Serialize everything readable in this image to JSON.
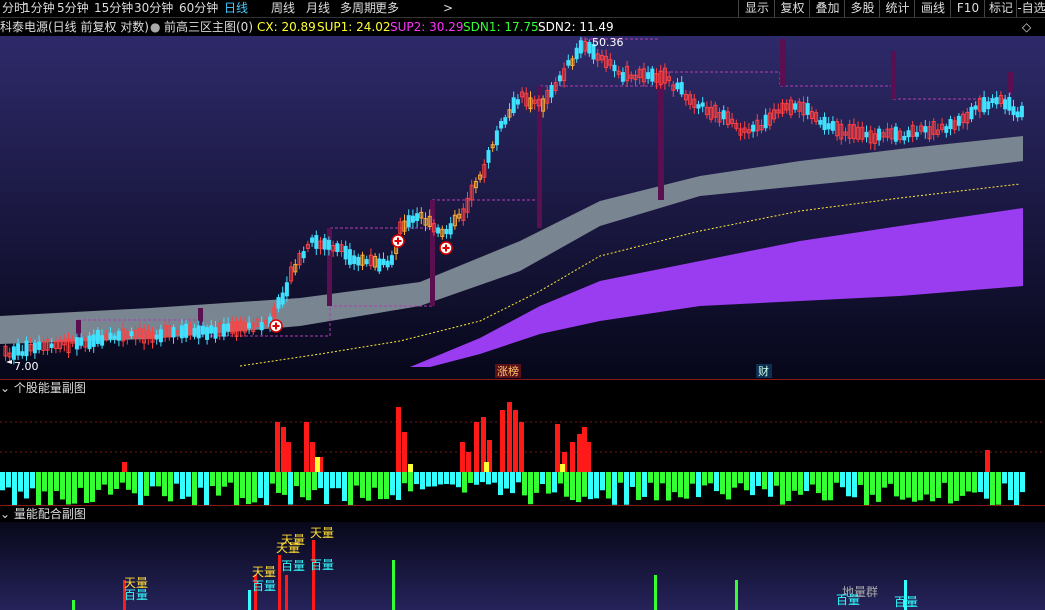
{
  "toolbar": {
    "timeframes": [
      "分时",
      "1分钟",
      "5分钟",
      "15分钟",
      "30分钟",
      "60分钟",
      "日线",
      "周线",
      "月线",
      "多周期",
      "更多"
    ],
    "active_index": 6,
    "more_arrow": ">",
    "right_buttons": [
      "显示",
      "复权",
      "叠加",
      "多股",
      "统计",
      "画线",
      "F10",
      "标记",
      "-自选"
    ]
  },
  "info": {
    "stock": "科泰电源(日线 前复权 对数)",
    "indicator": "前高三区主图(0)",
    "cx": "CX: 20.89",
    "sup1": "SUP1: 24.02",
    "sup2": "SUP2: 30.29",
    "sdn1": "SDN1: 17.75",
    "sdn2": "SDN2: 11.49",
    "diamond": "◇"
  },
  "main": {
    "high_label": "50.36",
    "low_label": "7.00",
    "tag1": "涨榜",
    "tag2": "财"
  },
  "panel2": {
    "title": "个股能量副图"
  },
  "panel3": {
    "title": "量能配合副图",
    "labels": {
      "tianliang": "天量",
      "bailiang": "百量",
      "dili": "地量群",
      "bai_cyan": "百量"
    }
  },
  "colors": {
    "up_candle": "#ff4040",
    "down_candle": "#40e0ff",
    "band_gray": "#7a8592",
    "band_purple": "#9a3cf0",
    "red_bar": "#ff1a1a",
    "yellow_bar": "#ffff33",
    "green_bar": "#33ff33",
    "cyan_bar": "#33ffff",
    "cx_color": "#ffff33",
    "sup1_color": "#ffff33",
    "sup2_color": "#ff33ff",
    "sdn1_color": "#33ff33",
    "sdn2_color": "#ffffff"
  }
}
